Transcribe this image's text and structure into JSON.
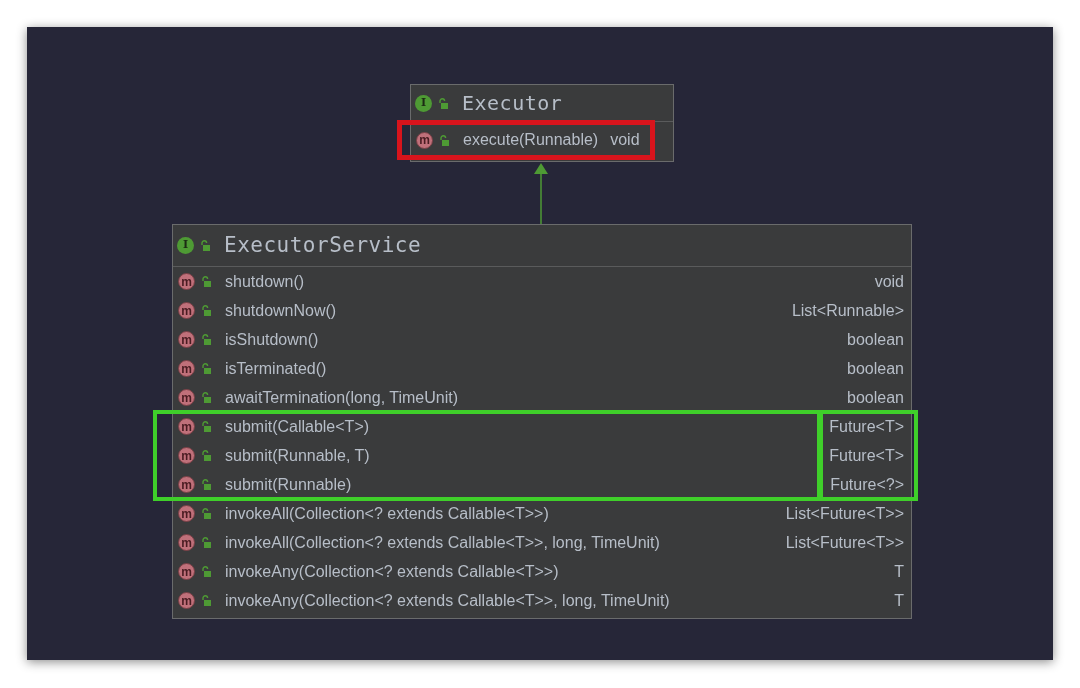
{
  "diagram": {
    "classes": [
      {
        "name": "Executor",
        "icon": "I",
        "methods": [
          {
            "icon": "m",
            "signature": "execute(Runnable)",
            "returns": "void",
            "color": "#d8141c"
          }
        ]
      },
      {
        "name": "ExecutorService",
        "icon": "I",
        "methods": [
          {
            "icon": "m",
            "signature": "shutdown()",
            "returns": "void"
          },
          {
            "icon": "m",
            "signature": "shutdownNow()",
            "returns": "List<Runnable>"
          },
          {
            "icon": "m",
            "signature": "isShutdown()",
            "returns": "boolean"
          },
          {
            "icon": "m",
            "signature": "isTerminated()",
            "returns": "boolean"
          },
          {
            "icon": "m",
            "signature": "awaitTermination(long, TimeUnit)",
            "returns": "boolean"
          },
          {
            "icon": "m",
            "signature": "submit(Callable<T>)",
            "returns": "Future<T>",
            "color": "#3fcf2a"
          },
          {
            "icon": "m",
            "signature": "submit(Runnable, T)",
            "returns": "Future<T>",
            "color": "#3fcf2a"
          },
          {
            "icon": "m",
            "signature": "submit(Runnable)",
            "returns": "Future<?>",
            "color": "#3fcf2a"
          },
          {
            "icon": "m",
            "signature": "invokeAll(Collection<? extends Callable<T>>)",
            "returns": "List<Future<T>>"
          },
          {
            "icon": "m",
            "signature": "invokeAll(Collection<? extends Callable<T>>, long, TimeUnit)",
            "returns": "List<Future<T>>"
          },
          {
            "icon": "m",
            "signature": "invokeAny(Collection<? extends Callable<T>>)",
            "returns": "T"
          },
          {
            "icon": "m",
            "signature": "invokeAny(Collection<? extends Callable<T>>, long, TimeUnit)",
            "returns": "T"
          }
        ]
      }
    ]
  }
}
